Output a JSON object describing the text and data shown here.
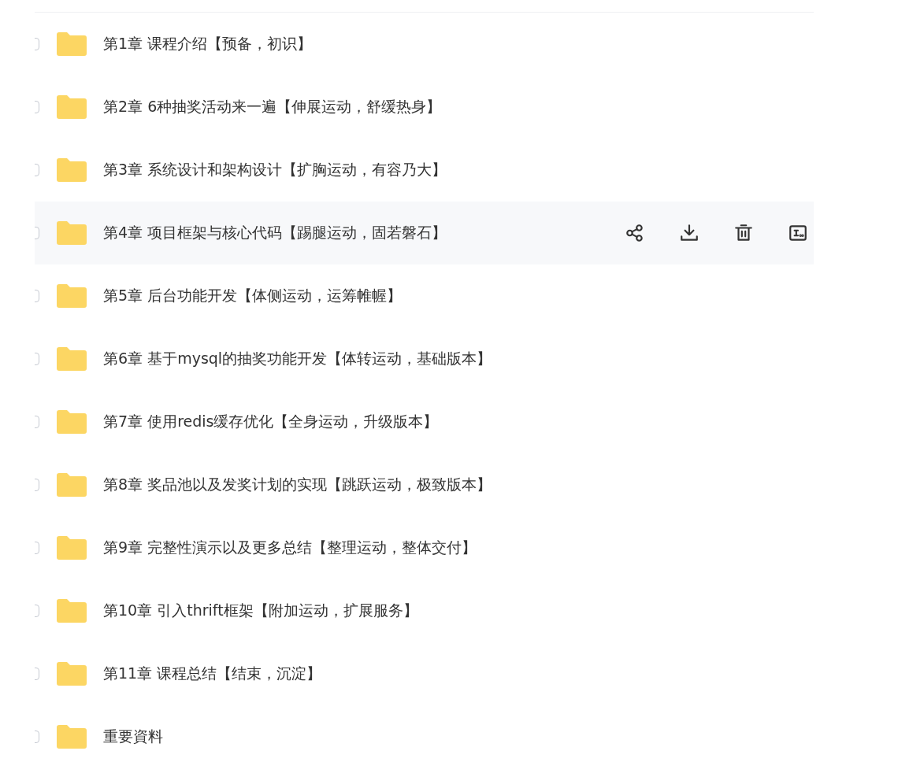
{
  "files": [
    {
      "name": "第1章 课程介绍【预备，初识】",
      "checked": false,
      "hovered": false
    },
    {
      "name": "第2章 6种抽奖活动来一遍【伸展运动，舒缓热身】",
      "checked": false,
      "hovered": false
    },
    {
      "name": "第3章 系统设计和架构设计【扩胸运动，有容乃大】",
      "checked": false,
      "hovered": false
    },
    {
      "name": "第4章 项目框架与核心代码【踢腿运动，固若磐石】",
      "checked": false,
      "hovered": true
    },
    {
      "name": "第5章 后台功能开发【体侧运动，运筹帷幄】",
      "checked": false,
      "hovered": false
    },
    {
      "name": "第6章 基于mysql的抽奖功能开发【体转运动，基础版本】",
      "checked": false,
      "hovered": false
    },
    {
      "name": "第7章 使用redis缓存优化【全身运动，升级版本】",
      "checked": false,
      "hovered": false
    },
    {
      "name": "第8章 奖品池以及发奖计划的实现【跳跃运动，极致版本】",
      "checked": false,
      "hovered": false
    },
    {
      "name": "第9章 完整性演示以及更多总结【整理运动，整体交付】",
      "checked": false,
      "hovered": false
    },
    {
      "name": "第10章 引入thrift框架【附加运动，扩展服务】",
      "checked": false,
      "hovered": false
    },
    {
      "name": "第11章 课程总结【结束，沉淀】",
      "checked": false,
      "hovered": false
    },
    {
      "name": "重要資料",
      "checked": false,
      "hovered": false
    }
  ]
}
